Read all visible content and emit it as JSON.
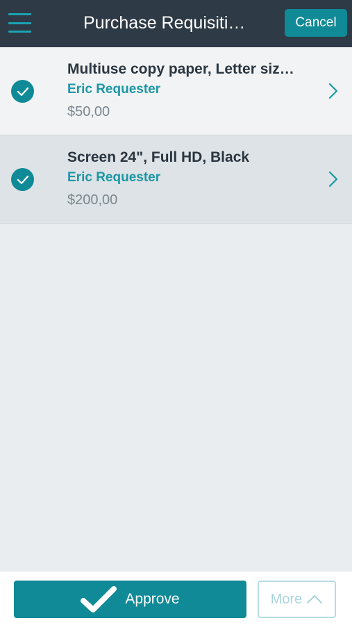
{
  "header": {
    "title": "Purchase Requisiti…",
    "menu_icon": "hamburger-menu-icon",
    "cancel_label": "Cancel"
  },
  "items": [
    {
      "title": "Multiuse copy paper, Letter siz…",
      "requester": "Eric Requester",
      "amount": "$50,00",
      "selected": true
    },
    {
      "title": "Screen 24\", Full HD, Black",
      "requester": "Eric Requester",
      "amount": "$200,00",
      "selected": true
    }
  ],
  "footer": {
    "approve_label": "Approve",
    "more_label": "More"
  },
  "colors": {
    "header_bg": "#2e3a46",
    "accent": "#0f8a96",
    "accent_light": "#1c97a5",
    "background": "#eaedef"
  }
}
